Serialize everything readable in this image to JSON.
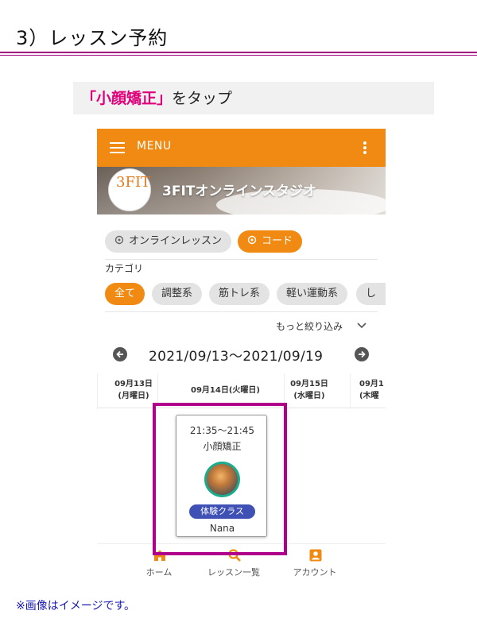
{
  "heading": "3）レッスン予約",
  "instruction": {
    "highlight": "「小顔矯正」",
    "rest": "をタップ"
  },
  "app": {
    "menu_label": "MENU",
    "studio_title": "3FITオンラインスタジオ",
    "logo_text": "3FIT",
    "type_chips": [
      {
        "label": "オンラインレッスン",
        "active": false
      },
      {
        "label": "コード",
        "active": true
      }
    ],
    "category_label": "カテゴリ",
    "categories": [
      {
        "label": "全て",
        "active": true
      },
      {
        "label": "調整系",
        "active": false
      },
      {
        "label": "筋トレ系",
        "active": false
      },
      {
        "label": "軽い運動系",
        "active": false
      },
      {
        "label": "し",
        "active": false
      }
    ],
    "filter_more": "もっと絞り込み",
    "date_range": "2021/09/13〜2021/09/19",
    "days": [
      {
        "date": "09月13日",
        "weekday": "(月曜日)"
      },
      {
        "date": "09月14日(火曜日)",
        "weekday": ""
      },
      {
        "date": "09月15日",
        "weekday": "(水曜日)"
      },
      {
        "date": "09月1",
        "weekday": "(木曜"
      }
    ],
    "lesson": {
      "time": "21:35〜21:45",
      "name": "小顔矯正",
      "badge": "体験クラス",
      "instructor": "Nana"
    },
    "bottom_nav": [
      {
        "label": "ホーム",
        "icon": "home-icon"
      },
      {
        "label": "レッスン一覧",
        "icon": "search-icon"
      },
      {
        "label": "アカウント",
        "icon": "account-icon"
      }
    ]
  },
  "colors": {
    "accent": "#f18a12",
    "highlight": "#b0008b",
    "badge": "#3f51b5"
  },
  "note": "※画像はイメージです。"
}
